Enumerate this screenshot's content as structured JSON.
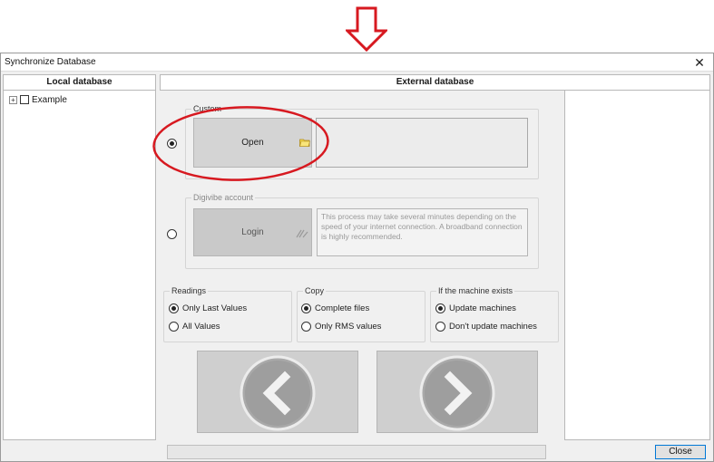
{
  "window": {
    "title": "Synchronize Database",
    "close_glyph": "✕"
  },
  "headers": {
    "local": "Local database",
    "external": "External database"
  },
  "tree": {
    "expander_glyph": "+",
    "items": [
      {
        "label": "Example",
        "checked": false
      }
    ]
  },
  "custom": {
    "group_title": "Custom",
    "selected": true,
    "open_label": "Open",
    "icon": "folder-icon",
    "path_value": ""
  },
  "digivibe": {
    "group_title": "Digivibe account",
    "selected": false,
    "login_label": "Login",
    "icon": "login-icon",
    "note": "This process may take several minutes depending on the speed of your internet connection. A broadband connection is highly recommended."
  },
  "readings": {
    "title": "Readings",
    "options": [
      {
        "label": "Only Last Values",
        "selected": true
      },
      {
        "label": "All Values",
        "selected": false
      }
    ]
  },
  "copy": {
    "title": "Copy",
    "options": [
      {
        "label": "Complete files",
        "selected": true
      },
      {
        "label": "Only RMS values",
        "selected": false
      }
    ]
  },
  "machine": {
    "title": "If the machine exists",
    "options": [
      {
        "label": "Update machines",
        "selected": true
      },
      {
        "label": "Don't update machines",
        "selected": false
      }
    ]
  },
  "nav": {
    "back_icon": "chevron-left-icon",
    "next_icon": "chevron-right-icon"
  },
  "footer": {
    "close_label": "Close"
  },
  "colors": {
    "annotation": "#d71920",
    "focus": "#0078d7"
  }
}
